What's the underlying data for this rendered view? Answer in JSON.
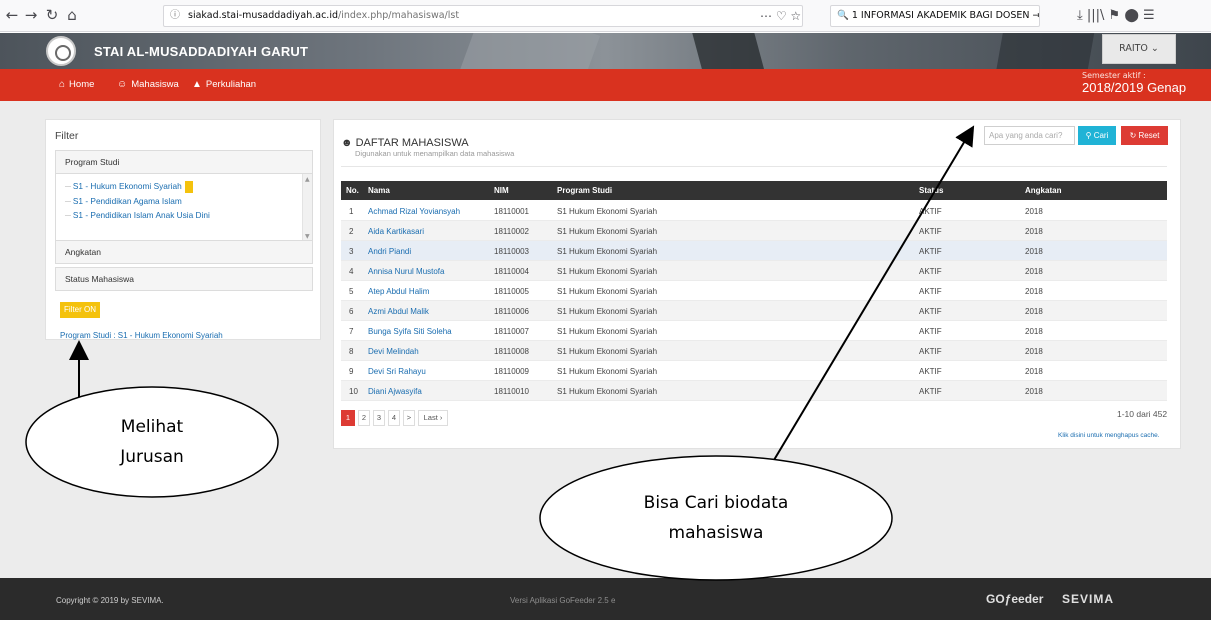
{
  "browser": {
    "back_icon": "back-arrow-icon",
    "url_info_icon": "info-icon",
    "url_host": "siakad.stai-musaddadiyah.ac.id",
    "url_path": "/index.php/mahasiswa/lst",
    "url_tools": "⋯ ♡ ☆",
    "search_text": "1 INFORMASI AKADEMIK BAGI DOSEN →",
    "toolbar_icons": "⤓  |||\\  ⚑  ⬤  ☰"
  },
  "header": {
    "site_name": "STAI AL-MUSADDADIYAH GARUT",
    "user_button": "RAITO ⌄",
    "semester_label": "Semester aktif :",
    "semester_value": "2018/2019 Genap"
  },
  "nav": {
    "items": [
      {
        "label": "Home",
        "icon": "home-icon"
      },
      {
        "label": "Mahasiswa",
        "icon": "users-icon"
      },
      {
        "label": "Perkuliahan",
        "icon": "graduation-cap-icon"
      }
    ]
  },
  "filter": {
    "title": "Filter",
    "sections": [
      "Program Studi",
      "Angkatan",
      "Status Mahasiswa"
    ],
    "prodi_items": [
      "S1 - Hukum Ekonomi Syariah",
      "S1 - Pendidikan Agama Islam",
      "S1 - Pendidikan Islam Anak Usia Dini"
    ],
    "filter_on": "Filter ON",
    "active_note": "Program Studi : S1 - Hukum Ekonomi Syariah"
  },
  "list": {
    "title": "DAFTAR MAHASISWA",
    "subtitle": "Digunakan untuk menampilkan data mahasiswa",
    "search_placeholder": "Apa yang anda cari?",
    "search_button": "Cari",
    "reset_button": "Reset",
    "columns": [
      "No.",
      "Nama",
      "NIM",
      "Program Studi",
      "Status",
      "Angkatan"
    ],
    "rows": [
      {
        "no": "1",
        "nama": "Achmad Rizal Yoviansyah",
        "nim": "18110001",
        "prodi": "S1 Hukum Ekonomi Syariah",
        "status": "AKTIF",
        "angkatan": "2018"
      },
      {
        "no": "2",
        "nama": "Aida Kartikasari",
        "nim": "18110002",
        "prodi": "S1 Hukum Ekonomi Syariah",
        "status": "AKTIF",
        "angkatan": "2018"
      },
      {
        "no": "3",
        "nama": "Andri Piandi",
        "nim": "18110003",
        "prodi": "S1 Hukum Ekonomi Syariah",
        "status": "AKTIF",
        "angkatan": "2018"
      },
      {
        "no": "4",
        "nama": "Annisa Nurul Mustofa",
        "nim": "18110004",
        "prodi": "S1 Hukum Ekonomi Syariah",
        "status": "AKTIF",
        "angkatan": "2018"
      },
      {
        "no": "5",
        "nama": "Atep Abdul Halim",
        "nim": "18110005",
        "prodi": "S1 Hukum Ekonomi Syariah",
        "status": "AKTIF",
        "angkatan": "2018"
      },
      {
        "no": "6",
        "nama": "Azmi Abdul Malik",
        "nim": "18110006",
        "prodi": "S1 Hukum Ekonomi Syariah",
        "status": "AKTIF",
        "angkatan": "2018"
      },
      {
        "no": "7",
        "nama": "Bunga Syifa Siti Soleha",
        "nim": "18110007",
        "prodi": "S1 Hukum Ekonomi Syariah",
        "status": "AKTIF",
        "angkatan": "2018"
      },
      {
        "no": "8",
        "nama": "Devi Melindah",
        "nim": "18110008",
        "prodi": "S1 Hukum Ekonomi Syariah",
        "status": "AKTIF",
        "angkatan": "2018"
      },
      {
        "no": "9",
        "nama": "Devi Sri Rahayu",
        "nim": "18110009",
        "prodi": "S1 Hukum Ekonomi Syariah",
        "status": "AKTIF",
        "angkatan": "2018"
      },
      {
        "no": "10",
        "nama": "Diani Ajwasyifa",
        "nim": "18110010",
        "prodi": "S1 Hukum Ekonomi Syariah",
        "status": "AKTIF",
        "angkatan": "2018"
      }
    ],
    "pages": [
      "1",
      "2",
      "3",
      "4",
      ">",
      "Last ›"
    ],
    "active_page": "1",
    "range_text": "1-10 dari 452",
    "cache_link": "Klik disini untuk menghapus cache."
  },
  "footer": {
    "copyright": "Copyright © 2019 by SEVIMA.",
    "version": "Versi Aplikasi GoFeeder 2.5 e",
    "logo_gofeeder": "GOƒeeder",
    "logo_sevima": "SEVIMA"
  },
  "annotations": {
    "left_callout": [
      "Melihat",
      "Jurusan"
    ],
    "right_callout": [
      "Bisa Cari biodata",
      "mahasiswa"
    ]
  },
  "colors": {
    "nav_red": "#d9321f",
    "table_header": "#333333",
    "link_blue": "#1a6db0",
    "btn_cari": "#20b3d6",
    "btn_reset": "#dd3b34",
    "filter_on": "#f4c20d"
  }
}
